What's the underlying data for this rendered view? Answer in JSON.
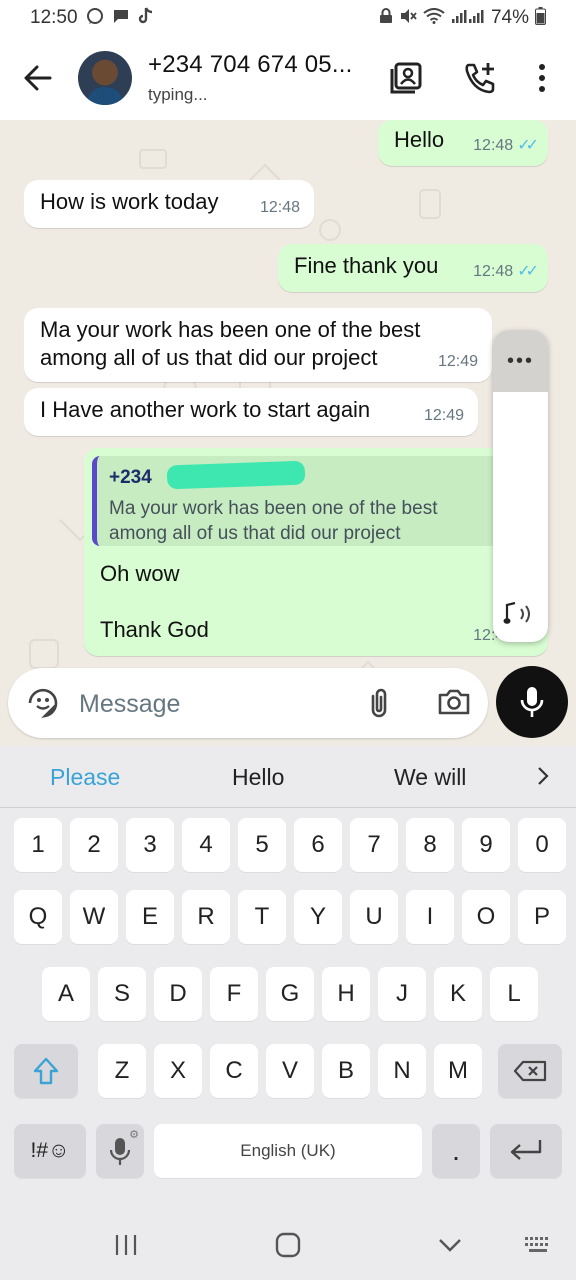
{
  "status_bar": {
    "time": "12:50",
    "battery": "74%"
  },
  "header": {
    "contact_name": "+234 704 674 05...",
    "status": "typing..."
  },
  "messages": [
    {
      "dir": "out",
      "text": "Hello",
      "time": "12:48"
    },
    {
      "dir": "in",
      "text": "How is work today",
      "time": "12:48"
    },
    {
      "dir": "out",
      "text": "Fine thank you",
      "time": "12:48"
    },
    {
      "dir": "in",
      "text_line1": "Ma your work has been one of the best",
      "text_line2": "among all of us that did our project",
      "time": "12:49"
    },
    {
      "dir": "in",
      "text": "I Have another work to start again",
      "time": "12:49"
    },
    {
      "dir": "out",
      "quote_name": "+234",
      "quote_line1": "Ma your work has been one of the best",
      "quote_line2": "among all of us that did our project",
      "line1": "Oh wow",
      "line2": "Thank God",
      "time": "12:49"
    }
  ],
  "composer": {
    "placeholder": "Message"
  },
  "keyboard": {
    "suggestions": [
      "Please",
      "Hello",
      "We will"
    ],
    "row_numbers": [
      "1",
      "2",
      "3",
      "4",
      "5",
      "6",
      "7",
      "8",
      "9",
      "0"
    ],
    "row_1": [
      "Q",
      "W",
      "E",
      "R",
      "T",
      "Y",
      "U",
      "I",
      "O",
      "P"
    ],
    "row_2": [
      "A",
      "S",
      "D",
      "F",
      "G",
      "H",
      "J",
      "K",
      "L"
    ],
    "row_3": [
      "Z",
      "X",
      "C",
      "V",
      "B",
      "N",
      "M"
    ],
    "symbols_label": "!#☺",
    "space_label": "English (UK)",
    "period": "."
  },
  "colors": {
    "chat_bg": "#efeae2",
    "outgoing_bubble": "#d9fdd3",
    "incoming_bubble": "#ffffff",
    "read_ticks": "#53bdeb",
    "suggestion_accent": "#3aa3d6"
  }
}
